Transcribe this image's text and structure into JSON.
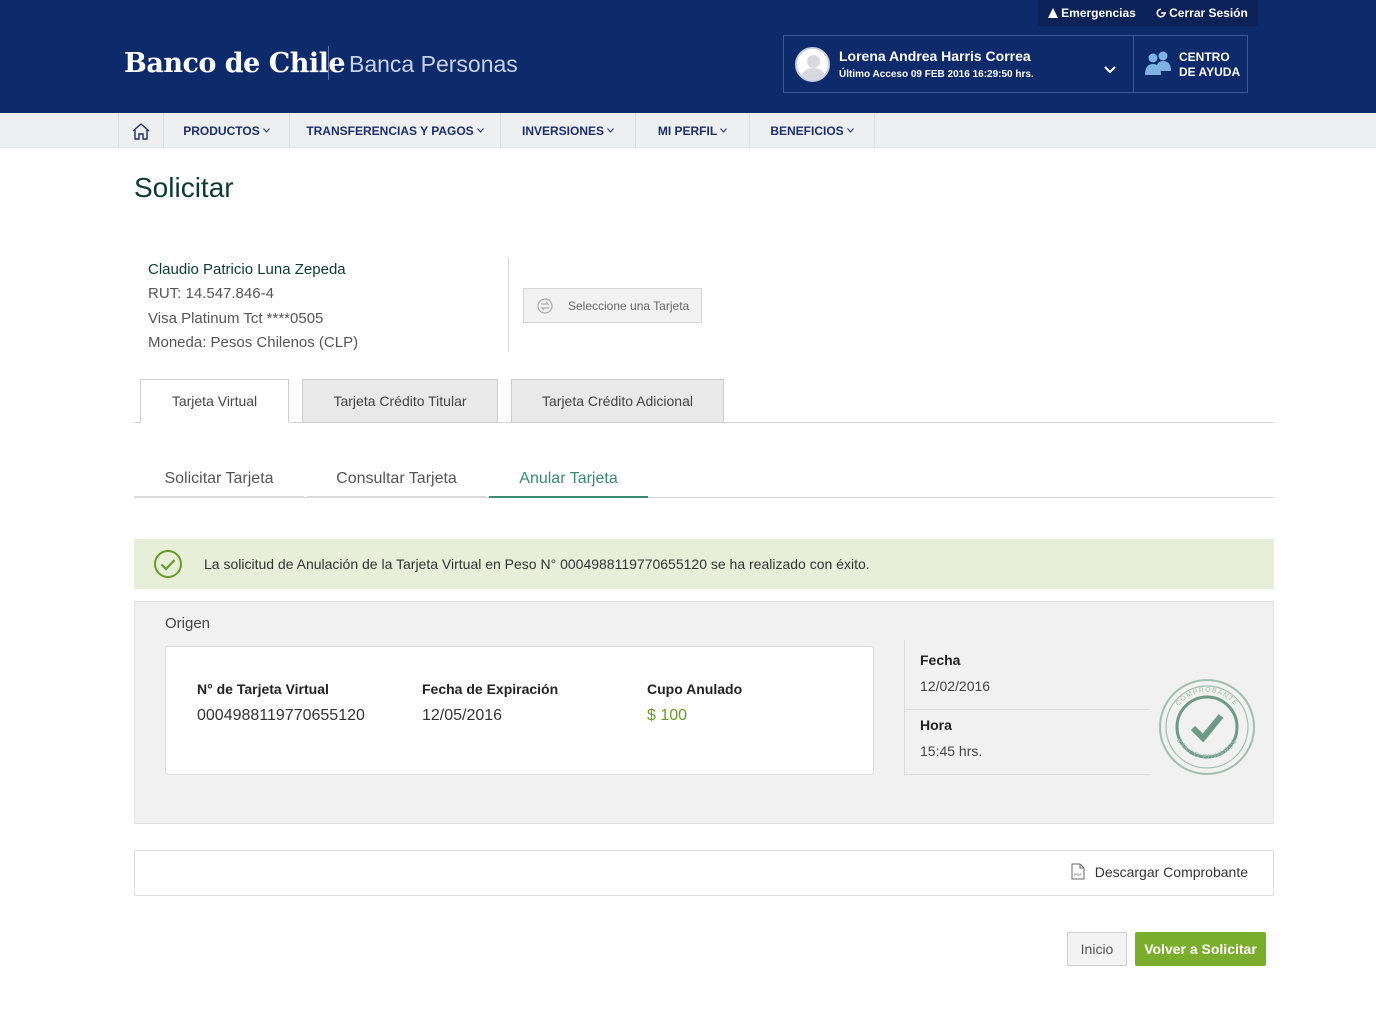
{
  "header": {
    "emergencias": "Emergencias",
    "cerrar_sesion": "Cerrar Sesión",
    "logo": "Banco de Chile",
    "subtitle": "Banca Personas",
    "user_name": "Lorena Andrea Harris Correa",
    "last_access": "Último Acceso 09 FEB 2016 16:29:50 hrs.",
    "help_label": "CENTRO\nDE AYUDA",
    "brand_color": "#0d2a6b"
  },
  "nav": {
    "items": [
      "PRODUCTOS",
      "TRANSFERENCIAS Y PAGOS",
      "INVERSIONES",
      "MI PERFIL",
      "BENEFICIOS"
    ]
  },
  "page": {
    "title": "Solicitar"
  },
  "client": {
    "name": "Claudio Patricio Luna Zepeda",
    "rut": "RUT: 14.547.846-4",
    "card": "Visa Platinum Tct ****0505",
    "currency": "Moneda: Pesos Chilenos (CLP)",
    "select_card": "Seleccione una Tarjeta"
  },
  "tabs": [
    "Tarjeta Virtual",
    "Tarjeta Crédito Titular",
    "Tarjeta Crédito Adicional"
  ],
  "subtabs": [
    "Solicitar Tarjeta",
    "Consultar Tarjeta",
    "Anular Tarjeta"
  ],
  "success_message": "La solicitud de Anulación de la Tarjeta Virtual en Peso N° 0004988119770655120 se ha realizado con éxito.",
  "origin": {
    "title": "Origen",
    "card_number_label": "N° de Tarjeta Virtual",
    "card_number": "0004988119770655120",
    "expiration_label": "Fecha de Expiración",
    "expiration": "12/05/2016",
    "amount_label": "Cupo Anulado",
    "amount": "$ 100",
    "date_label": "Fecha",
    "date": "12/02/2016",
    "time_label": "Hora",
    "time": "15:45 hrs.",
    "stamp_top": "COMPROBANTE",
    "stamp_bottom": "BANCO EDWARDS"
  },
  "download": "Descargar Comprobante",
  "buttons": {
    "inicio": "Inicio",
    "volver": "Volver a Solicitar",
    "primary_color": "#7aad2c"
  }
}
